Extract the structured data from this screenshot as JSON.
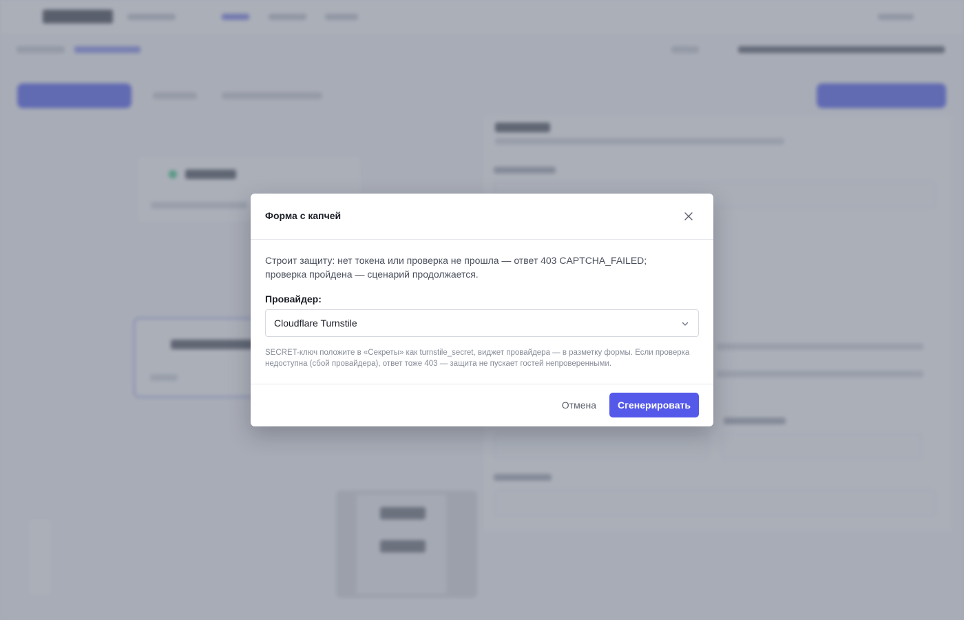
{
  "modal": {
    "title": "Форма с капчей",
    "close_icon": "close-icon",
    "description": "Строит защиту: нет токена или проверка не прошла — ответ 403 CAPTCHA_FAILED; проверка пройдена — сценарий продолжается.",
    "provider_label": "Провайдер:",
    "provider_value": "Cloudflare Turnstile",
    "provider_chevron_icon": "chevron-down-icon",
    "hint": "SECRET-ключ положите в «Секреты» как turnstile_secret, виджет провайдера — в разметку формы. Если проверка недоступна (сбой провайдера), ответ тоже 403 — защита не пускает гостей непроверенными.",
    "cancel_label": "Отмена",
    "submit_label": "Сгенерировать"
  },
  "colors": {
    "primary": "#5459ea",
    "overlay": "#787e8c"
  }
}
